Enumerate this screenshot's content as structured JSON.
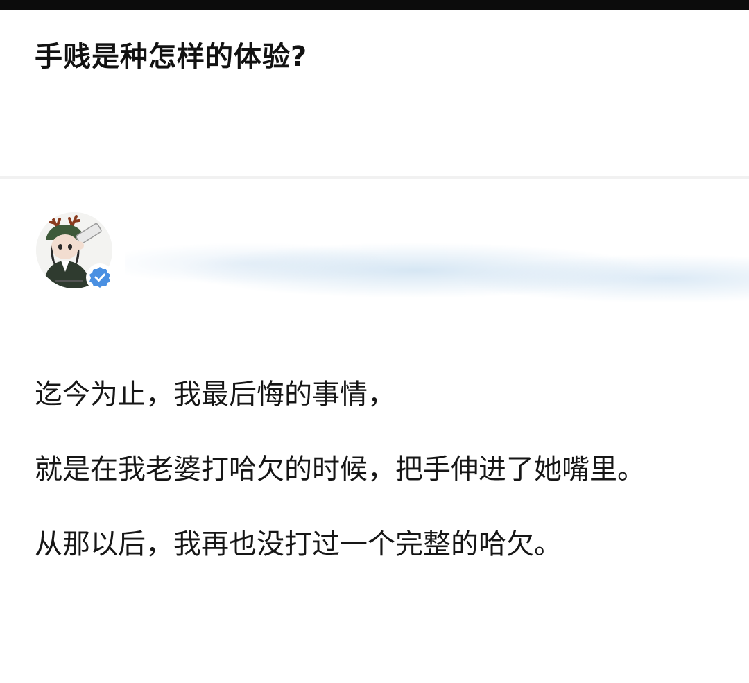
{
  "question": {
    "title": "手贱是种怎样的体验?"
  },
  "author": {
    "avatar_icon": "cartoon-avatar-drinking",
    "verified_icon": "verified-check-icon",
    "verified_color": "#4a90e2"
  },
  "answer": {
    "paragraphs": [
      "迄今为止，我最后悔的事情，",
      "就是在我老婆打哈欠的时候，把手伸进了她嘴里。",
      "从那以后，我再也没打过一个完整的哈欠。"
    ]
  }
}
